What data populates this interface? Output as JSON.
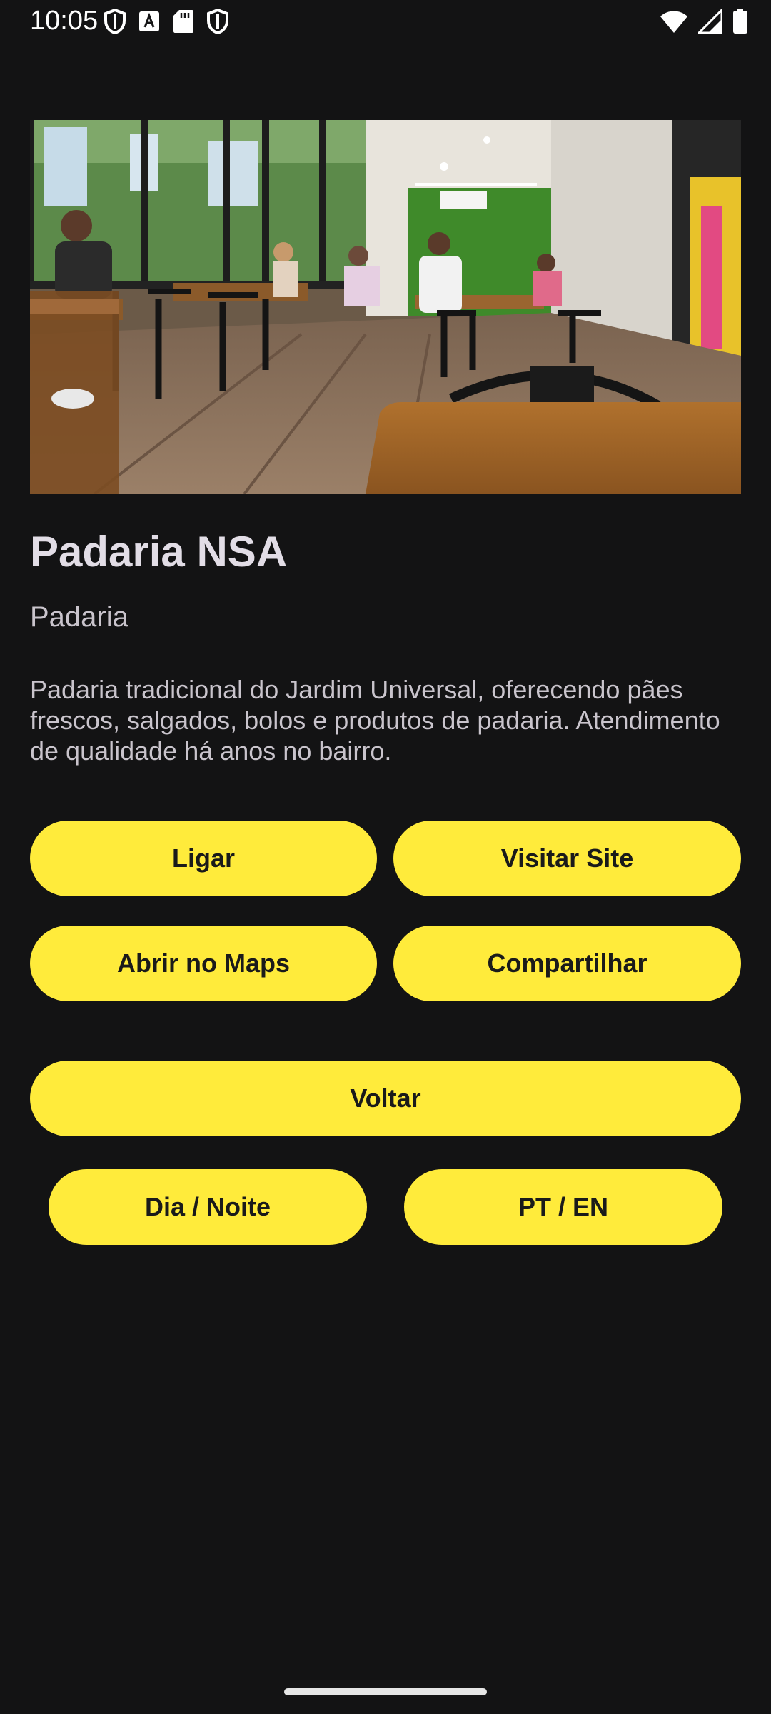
{
  "status_bar": {
    "time": "10:05",
    "left_icons": [
      "shield-icon",
      "font-a-icon",
      "sd-card-icon",
      "shield-icon"
    ],
    "right_icons": [
      "wifi-icon",
      "signal-icon",
      "battery-icon"
    ]
  },
  "place": {
    "image_icon": "restaurant-interior-photo",
    "name": "Padaria NSA",
    "category": "Padaria",
    "description": "Padaria tradicional do Jardim Universal, oferecendo pães frescos, salgados, bolos e produtos de padaria. Atendimento de qualidade há anos no bairro."
  },
  "actions": {
    "call": "Ligar",
    "visit_site": "Visitar Site",
    "open_maps": "Abrir no Maps",
    "share": "Compartilhar",
    "back": "Voltar",
    "theme_toggle": "Dia / Noite",
    "language_toggle": "PT / EN"
  },
  "colors": {
    "background": "#131314",
    "button": "#ffeb3b",
    "button_text": "#1a1a1a",
    "title": "#e2dde6",
    "body_text": "#c9c4cc"
  }
}
